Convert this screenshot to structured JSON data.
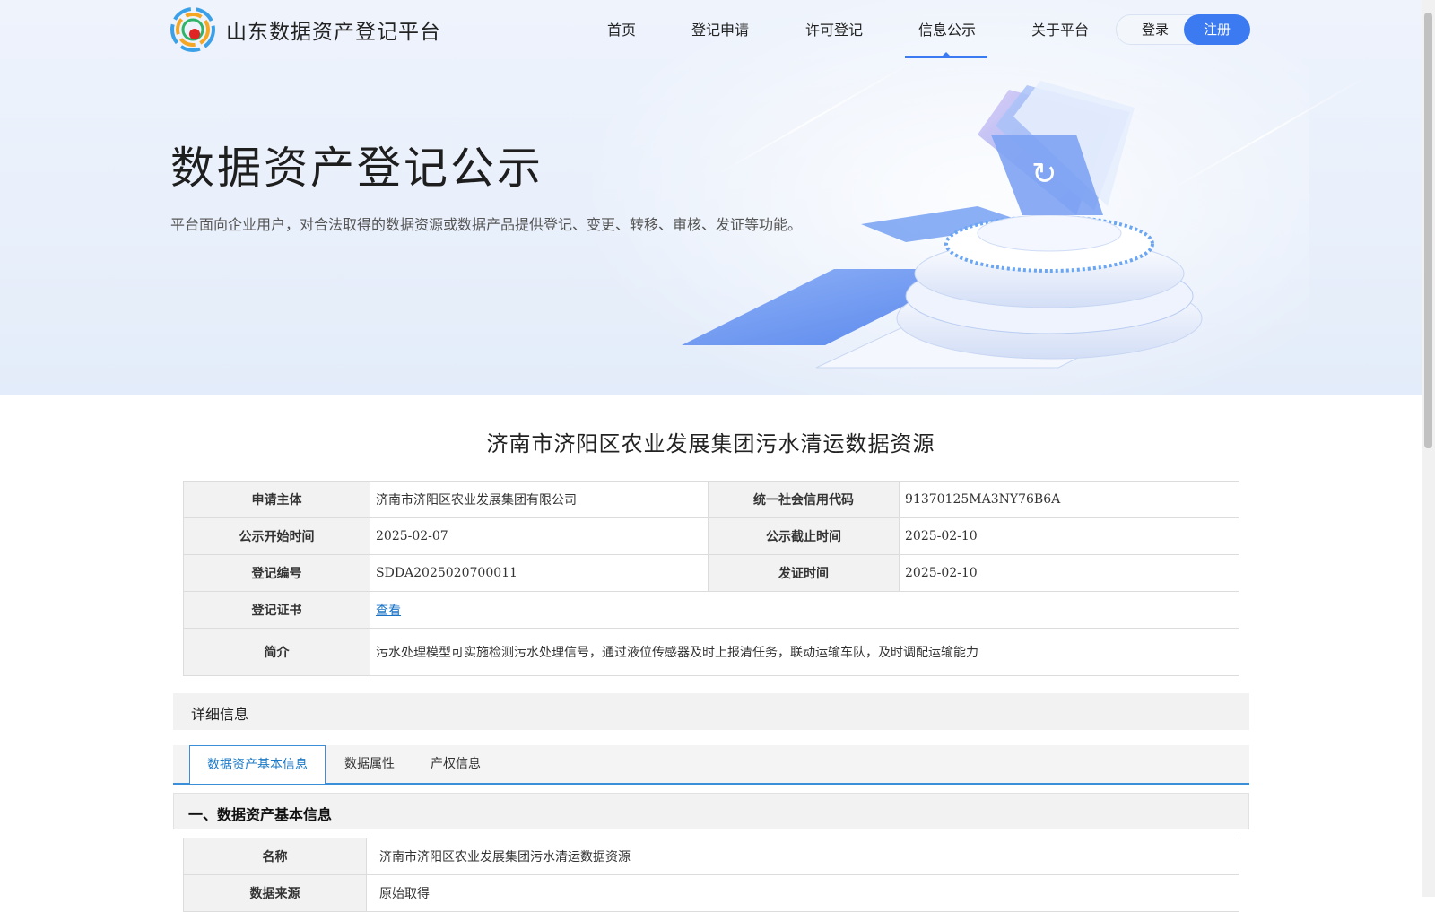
{
  "header": {
    "site_title": "山东数据资产登记平台",
    "nav": [
      "首页",
      "登记申请",
      "许可登记",
      "信息公示",
      "关于平台"
    ],
    "active_nav": "信息公示",
    "login": "登录",
    "register": "注册"
  },
  "hero": {
    "title": "数据资产登记公示",
    "description": "平台面向企业用户，对合法取得的数据资源或数据产品提供登记、变更、转移、审核、发证等功能。"
  },
  "record": {
    "title": "济南市济阳区农业发展集团污水清运数据资源",
    "rows": {
      "applicant_label": "申请主体",
      "applicant": "济南市济阳区农业发展集团有限公司",
      "credit_code_label": "统一社会信用代码",
      "credit_code": "91370125MA3NY76B6A",
      "start_label": "公示开始时间",
      "start": "2025-02-07",
      "end_label": "公示截止时间",
      "end": "2025-02-10",
      "reg_no_label": "登记编号",
      "reg_no": "SDDA2025020700011",
      "issue_label": "发证时间",
      "issue": "2025-02-10",
      "cert_label": "登记证书",
      "cert_link": "查看",
      "intro_label": "简介",
      "intro": "污水处理模型可实施检测污水处理信号，通过液位传感器及时上报清任务，联动运输车队，及时调配运输能力"
    }
  },
  "detail": {
    "heading": "详细信息",
    "tabs": [
      "数据资产基本信息",
      "数据属性",
      "产权信息"
    ],
    "active_tab": "数据资产基本信息",
    "section_title": "一、数据资产基本信息",
    "basic": [
      {
        "label": "名称",
        "value": "济南市济阳区农业发展集团污水清运数据资源"
      },
      {
        "label": "数据来源",
        "value": "原始取得"
      }
    ]
  },
  "colors": {
    "accent": "#3b7af0",
    "tab_accent": "#3b8fd9",
    "link": "#1a73c7"
  }
}
